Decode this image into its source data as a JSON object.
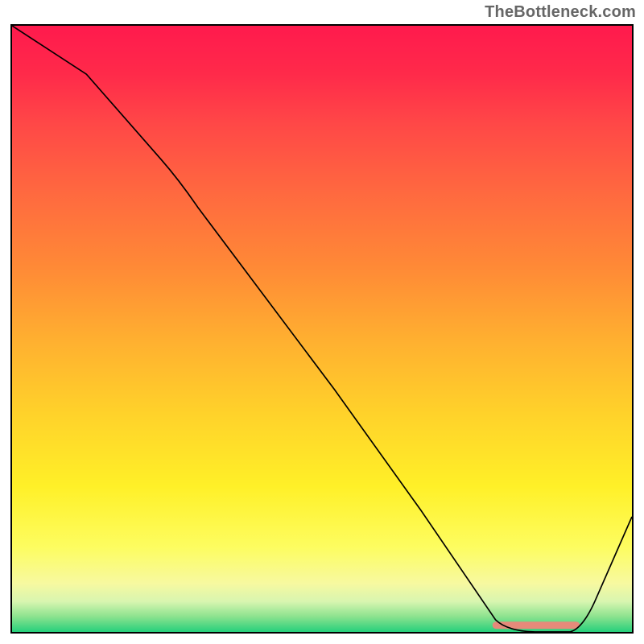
{
  "watermark": "TheBottleneck.com",
  "chart_data": {
    "type": "line",
    "x": [
      0.0,
      0.12,
      0.24,
      0.38,
      0.52,
      0.66,
      0.78,
      0.85,
      0.9,
      1.0
    ],
    "values": [
      1.0,
      0.92,
      0.78,
      0.6,
      0.4,
      0.2,
      0.02,
      0.0,
      0.0,
      0.19
    ],
    "title": "",
    "xlabel": "",
    "ylabel": "",
    "xlim": [
      0,
      1
    ],
    "ylim": [
      0,
      1
    ],
    "annotations": [
      {
        "type": "bar",
        "x0": 0.775,
        "x1": 0.916,
        "y": 0.005,
        "height": 0.012,
        "color": "#e68a7a"
      }
    ],
    "background_gradient": [
      "#ff1a4d",
      "#ff4747",
      "#ff8a36",
      "#ffd22a",
      "#fff028",
      "#fdfd60",
      "#8be28e",
      "#26d07c"
    ]
  }
}
